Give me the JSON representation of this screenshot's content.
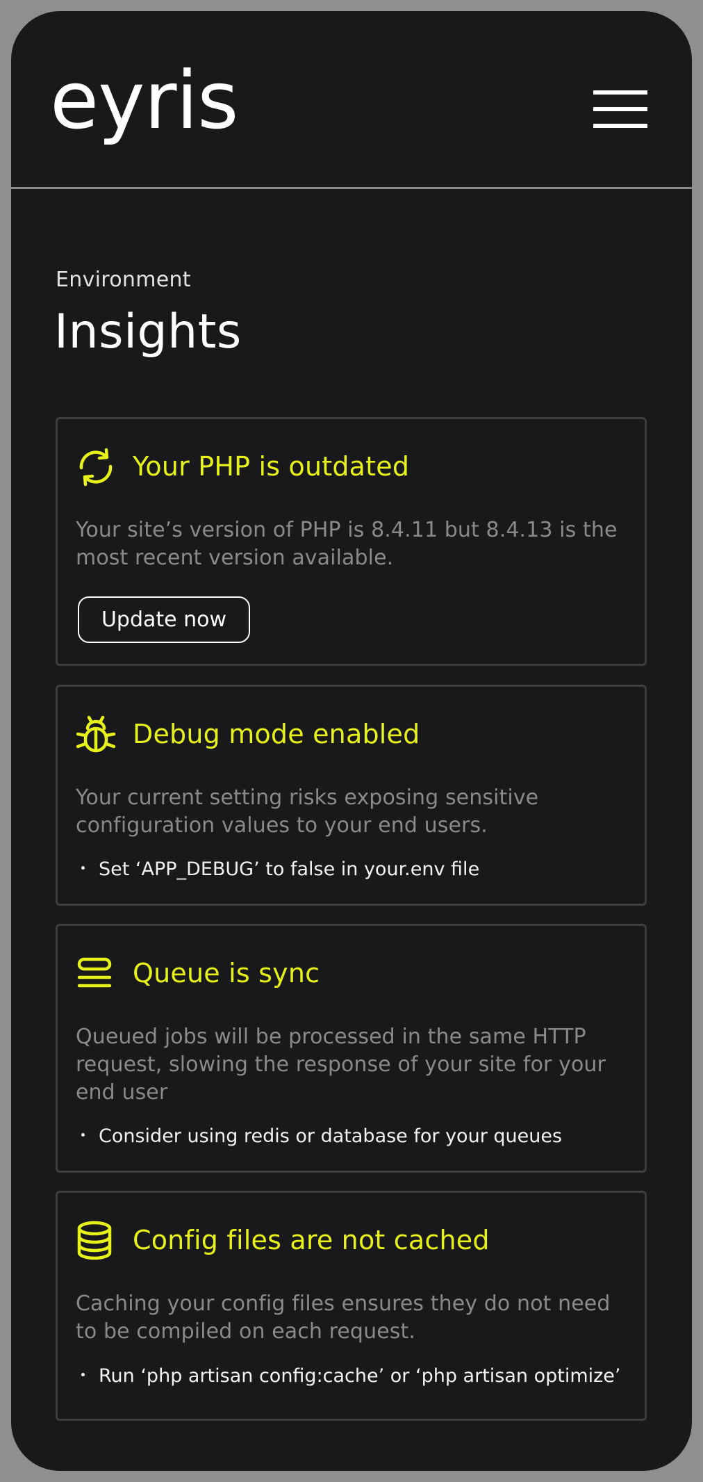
{
  "header": {
    "logo": "eyris",
    "menu_icon": "hamburger-menu-icon"
  },
  "page": {
    "eyebrow": "Environment",
    "title": "Insights"
  },
  "accent_color": "#e7f21a",
  "cards": [
    {
      "icon": "refresh-icon",
      "title": "Your PHP is outdated",
      "description": "Your site’s version of PHP is 8.4.11 but 8.4.13 is the most recent version available.",
      "button_label": "Update now"
    },
    {
      "icon": "bug-icon",
      "title": "Debug mode enabled",
      "description": "Your current setting risks exposing sensitive configuration values to your end users.",
      "bullet": "Set ‘APP_DEBUG’ to false in your.env file"
    },
    {
      "icon": "queue-stack-icon",
      "title": "Queue is sync",
      "description": "Queued jobs will be processed in the same HTTP request, slowing the response of your site for your end user",
      "bullet": "Consider using redis or database for your queues"
    },
    {
      "icon": "database-icon",
      "title": "Config files are not cached",
      "description": "Caching your config files ensures they do not need to be compiled on each request.",
      "bullet": "Run ‘php artisan config:cache’ or ‘php artisan optimize’"
    }
  ]
}
